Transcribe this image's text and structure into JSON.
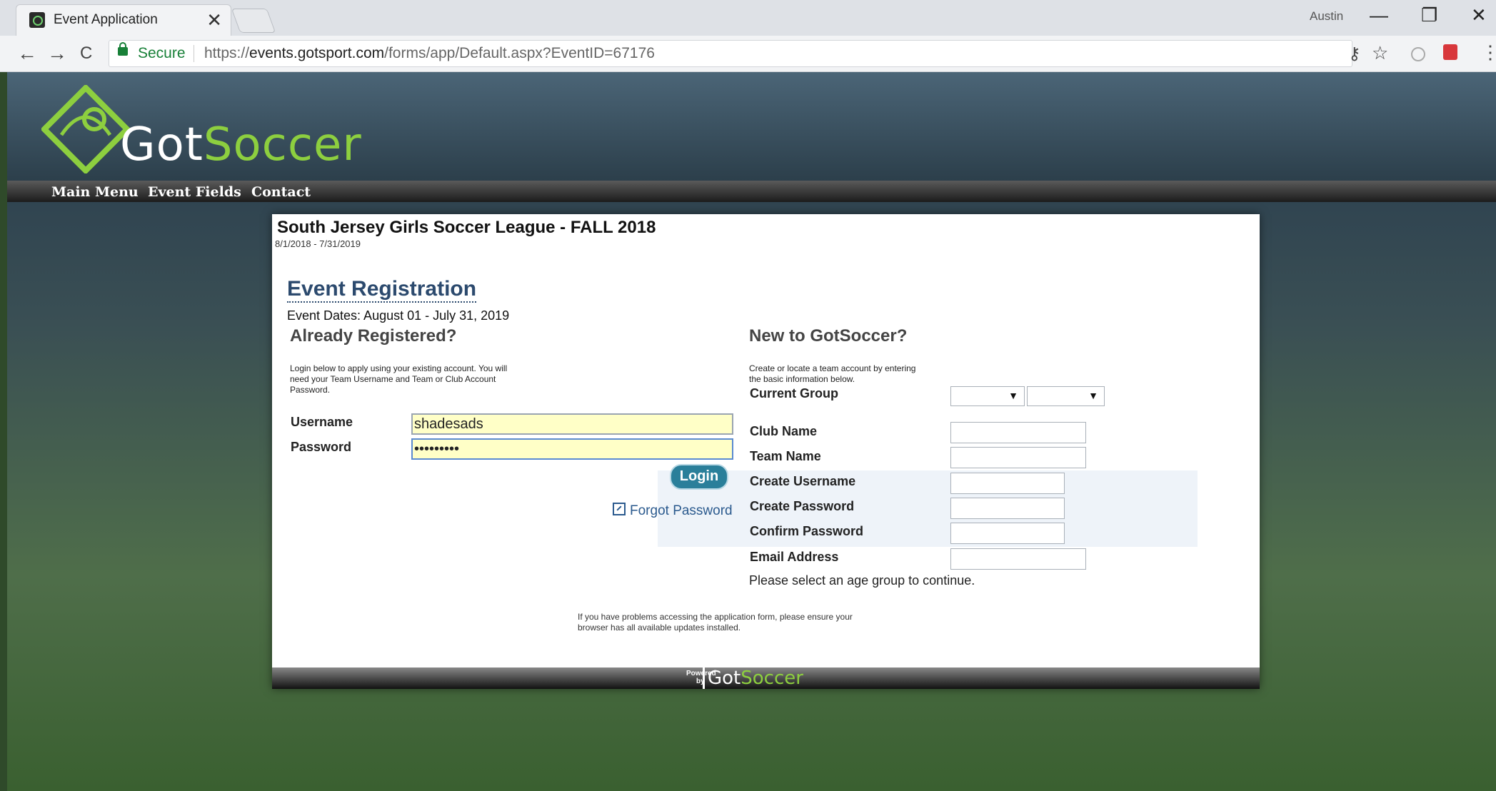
{
  "browser": {
    "tab_title": "Event Application",
    "tab_close": "✕",
    "profile_name": "Austin",
    "minimize": "—",
    "restore": "❐",
    "close": "✕",
    "back": "←",
    "forward": "→",
    "reload": "C",
    "secure_label": "Secure",
    "url_scheme": "https://",
    "url_host": "events.gotsport.com",
    "url_path": "/forms/app/Default.aspx?EventID=67176",
    "key_icon": "⚷",
    "star_icon": "☆",
    "menu_icon": "⋮"
  },
  "site": {
    "logo_part1": "Got",
    "logo_part2": "Soccer",
    "nav": [
      "Main Menu",
      "Event Fields",
      "Contact"
    ],
    "accent_color": "#8dcf3f"
  },
  "event": {
    "title": "South Jersey Girls Soccer League - FALL 2018",
    "date_range": "8/1/2018 - 7/31/2019",
    "registration_heading": "Event Registration",
    "registration_dates": "Event Dates: August 01 - July 31, 2019"
  },
  "login": {
    "heading": "Already Registered?",
    "note": "Login below to apply using your existing account. You will need your Team Username and Team or Club Account Password.",
    "username_label": "Username",
    "username_value": "shadesads",
    "password_label": "Password",
    "password_value": "•••••••••",
    "login_button": "Login",
    "forgot_link": "Forgot Password"
  },
  "signup": {
    "heading": "New to GotSoccer?",
    "note": "Create or locate a team account by entering the basic information below.",
    "current_group_label": "Current Group",
    "club_name_label": "Club Name",
    "team_name_label": "Team Name",
    "create_username_label": "Create Username",
    "create_password_label": "Create Password",
    "confirm_password_label": "Confirm Password",
    "email_label": "Email Address",
    "continue_message": "Please select an age group to continue.",
    "dropdown_arrow": "▼"
  },
  "notice": "If you have problems accessing the application form, please ensure your browser has all available updates installed.",
  "footer": {
    "powered_line1": "Powered",
    "powered_line2": "by",
    "logo_part1": "Got",
    "logo_part2": "Soccer"
  }
}
